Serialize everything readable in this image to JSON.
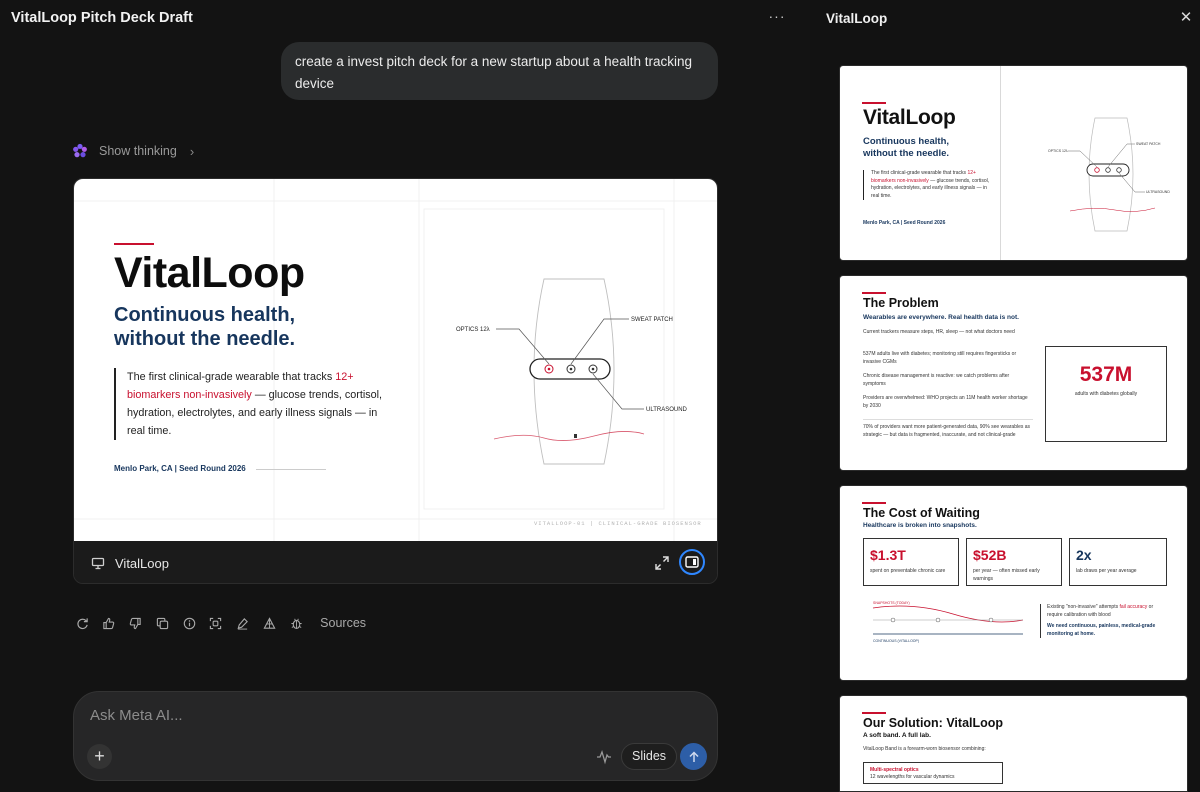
{
  "header": {
    "doc_title": "VitalLoop Pitch Deck Draft",
    "more_glyph": "···"
  },
  "chat": {
    "user_message": "create a invest pitch deck for a new startup about a health tracking device",
    "thinking_label": "Show thinking",
    "thinking_chevron": "›"
  },
  "card": {
    "name": "VitalLoop",
    "slide": {
      "title": "VitalLoop",
      "subtitle": "Continuous health, without the needle.",
      "body_pre": "The first clinical-grade wearable that tracks ",
      "body_red": "12+ biomarkers non-invasively",
      "body_post": " — glucose trends, cortisol, hydration, electrolytes, and early illness signals — in real time.",
      "footer": "Menlo Park, CA | Seed Round 2026",
      "callout_optics": "OPTICS 12λ",
      "callout_sweat": "SWEAT PATCH",
      "callout_ultra": "ULTRASOUND",
      "tagline": "VITALLOOP-01 | CLINICAL-GRADE BIOSENSOR"
    }
  },
  "actions": {
    "icons": [
      "regenerate-icon",
      "thumbs-up-icon",
      "thumbs-down-icon",
      "copy-icon",
      "info-icon",
      "scan-icon",
      "edit-icon",
      "share-icon",
      "bug-icon"
    ],
    "sources_label": "Sources"
  },
  "composer": {
    "placeholder": "Ask Meta AI...",
    "plus_glyph": "+",
    "mode_label": "Slides"
  },
  "side_panel": {
    "title": "VitalLoop",
    "close_glyph": "✕",
    "slide1": {
      "title": "VitalLoop",
      "subtitle": "Continuous health, without the needle.",
      "body_pre": "The first clinical-grade wearable that tracks ",
      "body_red": "12+ biomarkers non-invasively",
      "body_post": " — glucose trends, cortisol, hydration, electrolytes, and early illness signals — in real time.",
      "footer": "Menlo Park, CA | Seed Round 2026",
      "callout_optics": "OPTICS 12λ",
      "callout_sweat": "SWEAT PATCH",
      "callout_ultra": "ULTRASOUND"
    },
    "slide2": {
      "title": "The Problem",
      "subtitle": "Wearables are everywhere. Real health data is not.",
      "bullets": [
        "Current trackers measure steps, HR, sleep — not what doctors need",
        "537M adults live with diabetes; monitoring still requires fingersticks or invasive CGMs",
        "Chronic disease management is reactive: we catch problems after symptoms",
        "Providers are overwhelmed: WHO projects an 11M health worker shortage by 2030"
      ],
      "note": "70% of providers want more patient-generated data, 90% see wearables as strategic — but data is fragmented, inaccurate, and not clinical-grade",
      "stat_value": "537M",
      "stat_label": "adults with diabetes globally"
    },
    "slide3": {
      "title": "The Cost of Waiting",
      "subtitle": "Healthcare is broken into snapshots.",
      "stats": [
        {
          "value": "$1.3T",
          "label": "spent on preventable chronic care"
        },
        {
          "value": "$52B",
          "label": "per year — often missed early warnings"
        },
        {
          "value": "2x",
          "label": "lab draws per year average"
        }
      ],
      "chart_label_top": "SNAPSHOTS (TODAY)",
      "chart_label_bottom": "CONTINUOUS (VITALLOOP)",
      "side_pre": "Existing \"non-invasive\" attempts ",
      "side_red": "fail accuracy",
      "side_post": " or require calibration with blood",
      "side_strong": "We need continuous, painless, medical-grade monitoring at home."
    },
    "slide4": {
      "title": "Our Solution: VitalLoop",
      "subtitle": "A soft band. A full lab.",
      "body": "VitalLoop Band is a forearm-worn biosensor combining:",
      "item1": "Multi-spectral optics",
      "item1_sub": "12 wavelengths for vascular dynamics"
    }
  },
  "colors": {
    "accent_red": "#c8102e",
    "navy": "#17365d",
    "send_blue": "#2d5ea7",
    "focus_ring": "#2f87ff"
  }
}
